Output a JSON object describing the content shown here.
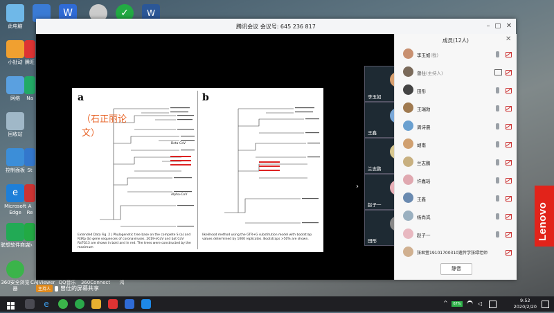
{
  "desktop": {
    "icons": [
      {
        "label": "此电脑",
        "icon": "computer-icon",
        "color": "#6fb8e8"
      },
      {
        "label": "",
        "icon": "app-icon",
        "color": "#3a7bd5"
      },
      {
        "label": "",
        "icon": "wps-icon",
        "color": "#2f6bd6"
      },
      {
        "label": "",
        "icon": "app-icon",
        "color": "#cccccc"
      },
      {
        "label": "",
        "icon": "check-icon",
        "color": "#22aa44"
      },
      {
        "label": "",
        "icon": "word-icon",
        "color": "#2b5797"
      },
      {
        "label": "小扯动",
        "icon": "document-icon",
        "color": "#f0a030"
      },
      {
        "label": "网络",
        "icon": "network-icon",
        "color": "#5aa0e0"
      },
      {
        "label": "回收站",
        "icon": "recycle-bin-icon",
        "color": "#a0b8c8"
      },
      {
        "label": "控制面板",
        "icon": "control-panel-icon",
        "color": "#3c8ed8"
      },
      {
        "label": "Microsoft Edge",
        "icon": "edge-icon",
        "color": "#1e7fd8"
      },
      {
        "label": "联想软件商店",
        "icon": "store-icon",
        "color": "#22aa55"
      },
      {
        "label": "360安全浏览器",
        "icon": "browser-360-icon",
        "color": "#3bb44a"
      }
    ],
    "partial_icons": [
      "腾旺",
      "Na",
      "St",
      "A",
      "Re",
      "小"
    ],
    "bottom_labels": [
      "CAJViewer 7.2",
      "QQ音乐",
      "360Connect",
      "鸿"
    ]
  },
  "brand": "Lenovo",
  "meeting": {
    "title": "腾讯会议 会议号: 645 236 817",
    "share_role": "主持人",
    "share_text": "曾仕的屏幕共享",
    "doc": {
      "label_a": "a",
      "label_b": "b",
      "stamp": "（石正丽论文）",
      "caption_a": "Extended Data Fig. 2 | Phylogenetic tree base on the complete S (a) and RdRp (b) gene sequences of coronaviruses. 2019-nCoV and bat CoV RaTG13 are shown in bold and in red. The trees were constructed by the maximum",
      "caption_b": "likelihood method using the GTR+G substitution model with bootstrap values determined by 1000 replicates. Bootstraps >50% are shown.",
      "clade_beta": "Beta-CoV",
      "clade_alpha": "Alpha-CoV"
    },
    "videos": [
      {
        "name": "李玉如",
        "color": "#d8a070"
      },
      {
        "name": "王鑫",
        "color": "#7aa8d8"
      },
      {
        "name": "兰志鹏",
        "color": "#d8c890"
      },
      {
        "name": "赵子一",
        "color": "#e8b0b8"
      },
      {
        "name": "田彤",
        "color": "#888888"
      }
    ]
  },
  "panel": {
    "title": "成员(12人)",
    "members": [
      {
        "name": "李玉如",
        "role": "(我)",
        "color": "#c89070",
        "mic": "muted"
      },
      {
        "name": "曾仕",
        "role": "(主持人)",
        "color": "#7a6a5a",
        "mic": "on"
      },
      {
        "name": "田彤",
        "role": "",
        "color": "#444444",
        "mic": "muted"
      },
      {
        "name": "王瑞勃",
        "role": "",
        "color": "#a07a50",
        "mic": "muted"
      },
      {
        "name": "周诗晨",
        "role": "",
        "color": "#6aa0d0",
        "mic": "muted"
      },
      {
        "name": "胡南",
        "role": "",
        "color": "#d0a070",
        "mic": "muted"
      },
      {
        "name": "兰志鹏",
        "role": "",
        "color": "#c8b080",
        "mic": "muted"
      },
      {
        "name": "许嘉瑶",
        "role": "",
        "color": "#e0a8b0",
        "mic": "muted"
      },
      {
        "name": "王鑫",
        "role": "",
        "color": "#6a8ab0",
        "mic": "muted"
      },
      {
        "name": "杨尚岚",
        "role": "",
        "color": "#9ab0c0",
        "mic": "muted"
      },
      {
        "name": "赵子一",
        "role": "",
        "color": "#e8b8c0",
        "mic": "muted"
      },
      {
        "name": "张君萱19101700310遗传学张绿老师",
        "role": "",
        "color": "#d0b090",
        "mic": "muted"
      }
    ],
    "mute_all": "静音"
  },
  "taskbar": {
    "battery": "67%",
    "time": "9:52",
    "date": "2020/2/20"
  }
}
